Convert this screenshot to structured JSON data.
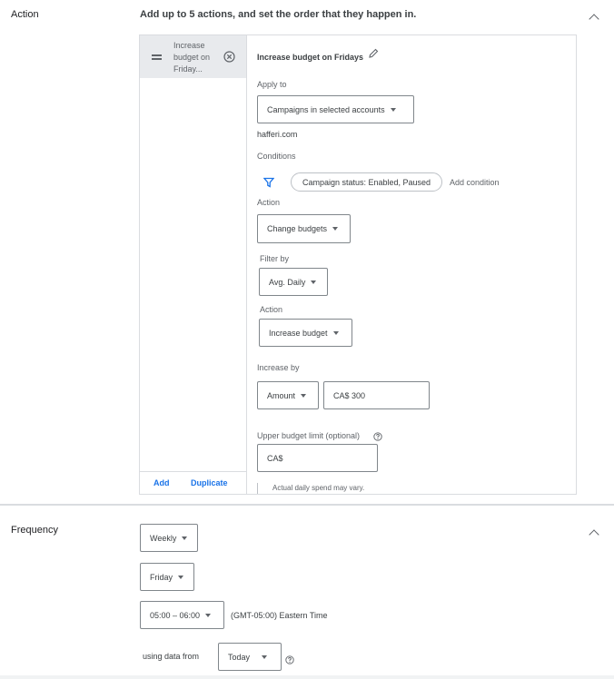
{
  "action_section": {
    "title": "Action",
    "description": "Add up to 5 actions, and set the order that they happen in.",
    "list": {
      "item_label": "Increase budget on Friday...",
      "add_label": "Add",
      "duplicate_label": "Duplicate"
    },
    "detail": {
      "title": "Increase budget on Fridays",
      "apply_to_label": "Apply to",
      "apply_to_value": "Campaigns in selected accounts",
      "account": "hafferi.com",
      "conditions_label": "Conditions",
      "condition_chip": "Campaign status: Enabled, Paused",
      "add_condition": "Add condition",
      "action_label": "Action",
      "action_value": "Change budgets",
      "filter_by_label": "Filter by",
      "filter_by_value": "Avg. Daily",
      "sub_action_label": "Action",
      "sub_action_value": "Increase budget",
      "increase_by_label": "Increase by",
      "increase_by_type": "Amount",
      "increase_by_amount": "CA$ 300",
      "upper_limit_label": "Upper budget limit (optional)",
      "upper_limit_value": "CA$",
      "note": "Actual daily spend may vary."
    }
  },
  "frequency_section": {
    "title": "Frequency",
    "period": "Weekly",
    "day": "Friday",
    "time": "05:00 – 06:00",
    "timezone": "(GMT-05:00) Eastern Time",
    "using_data_label": "using data from",
    "using_data_value": "Today"
  },
  "colors": {
    "accent": "#1a73e8",
    "text": "#202124",
    "border": "#dadce0"
  }
}
